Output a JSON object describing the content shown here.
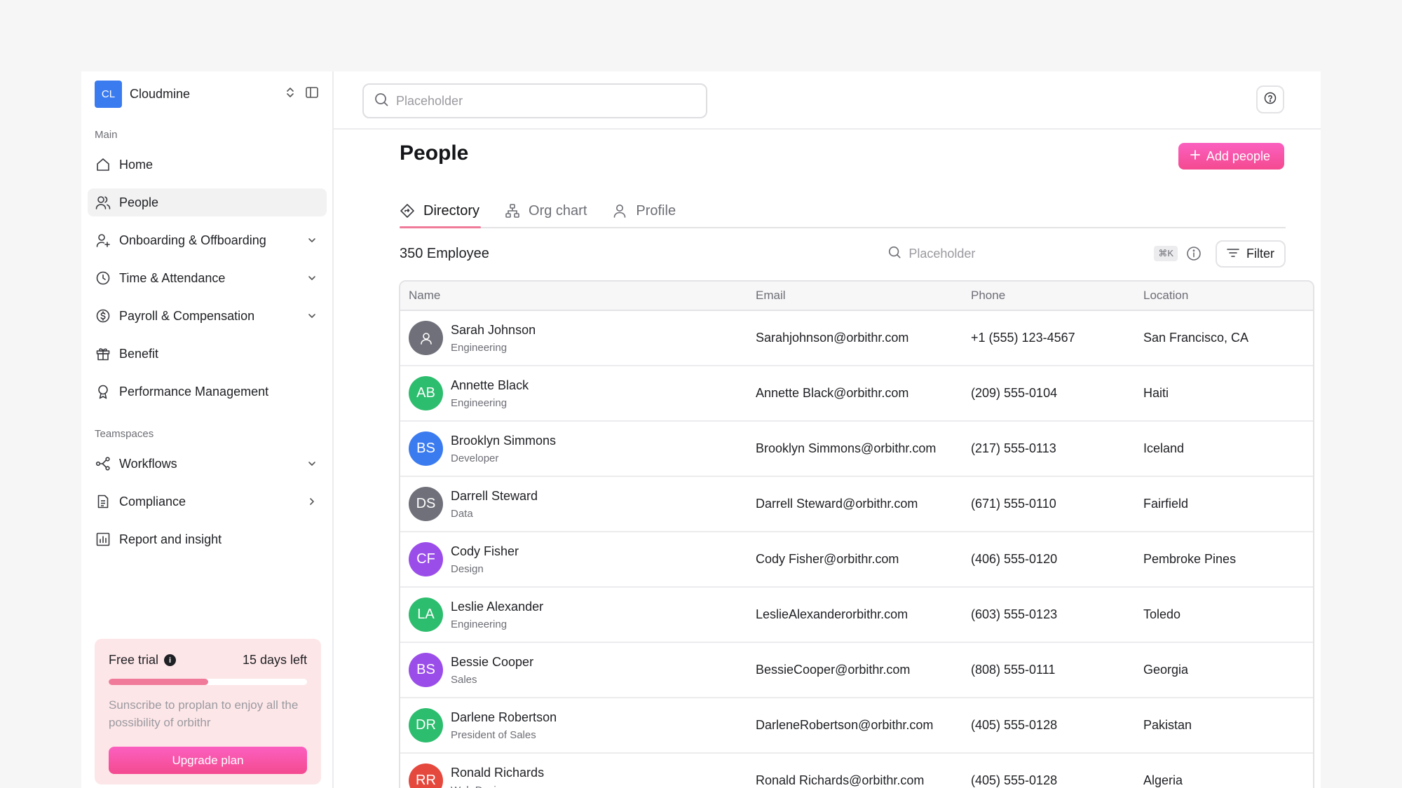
{
  "workspace": {
    "initials": "CL",
    "name": "Cloudmine",
    "logo_color": "#3b7bf0"
  },
  "sidebar": {
    "main_label": "Main",
    "main_items": [
      {
        "label": "Home",
        "icon": "home-icon"
      },
      {
        "label": "People",
        "icon": "users-icon",
        "active": true
      },
      {
        "label": "Onboarding & Offboarding",
        "icon": "user-plus-icon",
        "chevron": "down"
      },
      {
        "label": "Time & Attendance",
        "icon": "clock-icon",
        "chevron": "down"
      },
      {
        "label": "Payroll & Compensation",
        "icon": "dollar-circle-icon",
        "chevron": "down"
      },
      {
        "label": "Benefit",
        "icon": "gift-icon"
      },
      {
        "label": "Performance Management",
        "icon": "award-icon"
      }
    ],
    "team_label": "Teamspaces",
    "team_items": [
      {
        "label": "Workflows",
        "icon": "workflow-icon",
        "chevron": "down"
      },
      {
        "label": "Compliance",
        "icon": "document-icon",
        "chevron": "right"
      },
      {
        "label": "Report and insight",
        "icon": "bar-chart-icon"
      }
    ],
    "trial": {
      "title": "Free trial",
      "days_left": "15 days left",
      "progress": 0.5,
      "text": "Sunscribe to proplan to enjoy all the possibility of orbithr",
      "button": "Upgrade plan"
    }
  },
  "topbar": {
    "search_placeholder": "Placeholder"
  },
  "page": {
    "title": "People",
    "add_button": "Add people",
    "tabs": [
      {
        "label": "Directory",
        "icon": "directory-icon",
        "active": true
      },
      {
        "label": "Org chart",
        "icon": "org-chart-icon"
      },
      {
        "label": "Profile",
        "icon": "profile-icon"
      }
    ],
    "count": "350 Employee",
    "table_search_placeholder": "Placeholder",
    "shortcut": "⌘K",
    "filter": "Filter"
  },
  "table": {
    "headers": [
      "Name",
      "Email",
      "Phone",
      "Location"
    ],
    "rows": [
      {
        "initials": "",
        "color": "#6f7079",
        "name": "Sarah Johnson",
        "role": "Engineering",
        "email": "Sarahjohnson@orbithr.com",
        "phone": "+1 (555) 123-4567",
        "location": "San Francisco, CA"
      },
      {
        "initials": "AB",
        "color": "#2dbd6e",
        "name": "Annette Black",
        "role": "Engineering",
        "email": "Annette Black@orbithr.com",
        "phone": "(209) 555-0104",
        "location": "Haiti"
      },
      {
        "initials": "BS",
        "color": "#3b7bf0",
        "name": "Brooklyn Simmons",
        "role": "Developer",
        "email": "Brooklyn Simmons@orbithr.com",
        "phone": "(217) 555-0113",
        "location": "Iceland"
      },
      {
        "initials": "DS",
        "color": "#6f7079",
        "name": "Darrell Steward",
        "role": "Data",
        "email": "Darrell Steward@orbithr.com",
        "phone": "(671) 555-0110",
        "location": "Fairfield"
      },
      {
        "initials": "CF",
        "color": "#9b4dea",
        "name": "Cody Fisher",
        "role": "Design",
        "email": "Cody Fisher@orbithr.com",
        "phone": "(406) 555-0120",
        "location": "Pembroke Pines"
      },
      {
        "initials": "LA",
        "color": "#2dbd6e",
        "name": "Leslie Alexander",
        "role": "Engineering",
        "email": "LeslieAlexanderorbithr.com",
        "phone": "(603) 555-0123",
        "location": "Toledo"
      },
      {
        "initials": "BS",
        "color": "#9b4dea",
        "name": "Bessie Cooper",
        "role": "Sales",
        "email": "BessieCooper@orbithr.com",
        "phone": "(808) 555-0111",
        "location": "Georgia"
      },
      {
        "initials": "DR",
        "color": "#2dbd6e",
        "name": "Darlene Robertson",
        "role": "President of Sales",
        "email": "DarleneRobertson@orbithr.com",
        "phone": "(405) 555-0128",
        "location": "Pakistan"
      },
      {
        "initials": "RR",
        "color": "#e5483d",
        "name": "Ronald Richards",
        "role": "Web Designer",
        "email": "Ronald Richards@orbithr.com",
        "phone": "(405) 555-0128",
        "location": "Algeria"
      }
    ]
  }
}
